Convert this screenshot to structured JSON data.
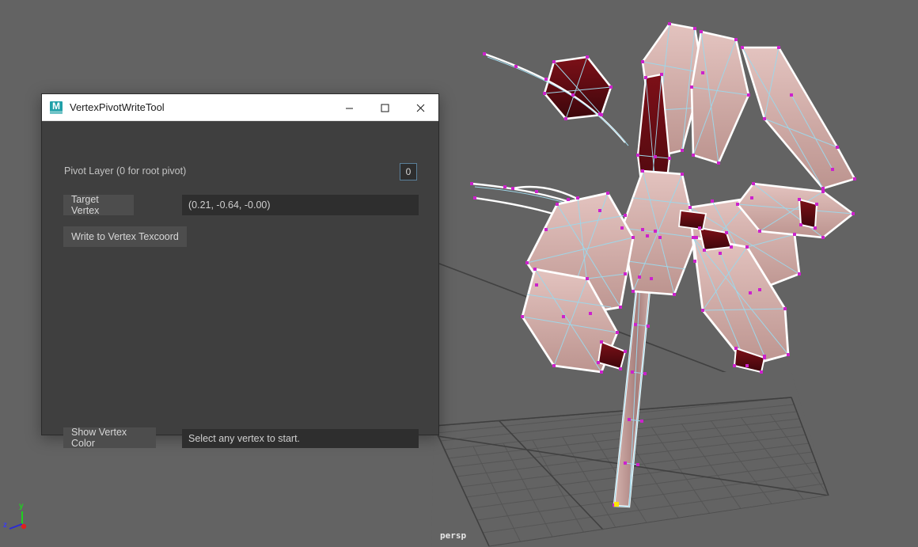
{
  "app": {
    "viewport_label": "persp",
    "background_color": "#636363"
  },
  "axis_gizmo": {
    "y_label": "y",
    "z_label": "z",
    "y_color": "#1fd11f",
    "z_color": "#2b2bd6",
    "x_color": "#e02020"
  },
  "window": {
    "title": "VertexPivotWriteTool",
    "icon": "maya-app-icon",
    "icon_letter": "M",
    "controls": {
      "minimize": "minimize-icon",
      "maximize": "maximize-icon",
      "close": "close-icon"
    }
  },
  "panel": {
    "pivot_layer_label": "Pivot Layer (0 for root pivot)",
    "pivot_layer_value": "0",
    "target_vertex_button": "Target Vertex",
    "target_vertex_value": "(0.21, -0.64, -0.00)",
    "write_button": "Write to Vertex Texcoord",
    "show_vertex_color_button": "Show Vertex Color",
    "status_text": "Select any vertex to start."
  },
  "colors": {
    "panel_bg": "#3f3f3f",
    "button_bg": "#4d4d4d",
    "field_bg": "#2e2e2e",
    "titlebar_bg": "#ffffff",
    "accent_border": "#5a7f99",
    "mesh_vertex": "#cc22cc",
    "mesh_vertex_selected": "#ffe400",
    "mesh_wire": "#9fd6e8",
    "mesh_face": "#cfa9a4",
    "mesh_face_inner": "#6e0e14",
    "mesh_outline": "#ffffff"
  }
}
